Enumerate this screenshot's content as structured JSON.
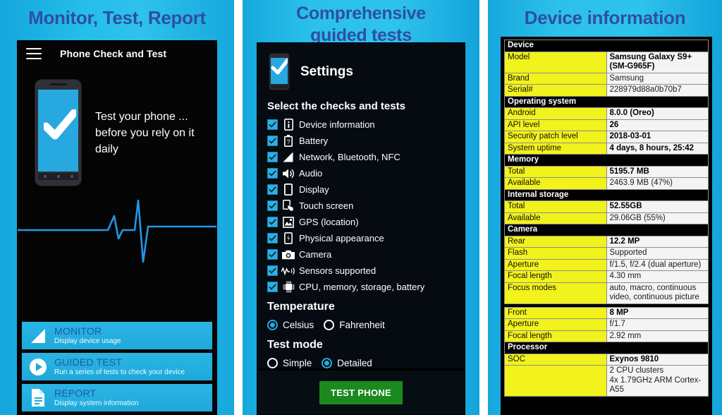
{
  "panels": {
    "left": {
      "headline": "Monitor, Test, Report",
      "app_title": "Phone Check and Test",
      "menu_icon": "hamburger-menu-icon",
      "hero_line1": "Test your phone ...",
      "hero_line2": "before you rely on it daily",
      "menu": [
        {
          "icon": "signal-bars-icon",
          "title": "MONITOR",
          "subtitle": "Display device usage"
        },
        {
          "icon": "play-circle-icon",
          "title": "GUIDED TEST",
          "subtitle": "Run a series of tests to check your device"
        },
        {
          "icon": "document-icon",
          "title": "REPORT",
          "subtitle": "Display system information"
        }
      ]
    },
    "middle": {
      "headline_line1": "Comprehensive",
      "headline_line2": "guided tests",
      "settings_title": "Settings",
      "select_title": "Select the checks and tests",
      "checks": [
        {
          "label": "Device information",
          "icon": "info-phone-icon",
          "checked": true
        },
        {
          "label": "Battery",
          "icon": "battery-question-icon",
          "checked": true
        },
        {
          "label": "Network, Bluetooth, NFC",
          "icon": "signal-bars-icon",
          "checked": true
        },
        {
          "label": "Audio",
          "icon": "speaker-icon",
          "checked": true
        },
        {
          "label": "Display",
          "icon": "phone-outline-icon",
          "checked": true
        },
        {
          "label": "Touch screen",
          "icon": "touch-hand-icon",
          "checked": true
        },
        {
          "label": "GPS (location)",
          "icon": "map-pin-icon",
          "checked": true
        },
        {
          "label": "Physical appearance",
          "icon": "phone-body-icon",
          "checked": true
        },
        {
          "label": "Camera",
          "icon": "camera-icon",
          "checked": true
        },
        {
          "label": "Sensors supported",
          "icon": "sensor-wave-icon",
          "checked": true
        },
        {
          "label": "CPU, memory, storage, battery",
          "icon": "cpu-chip-icon",
          "checked": true
        }
      ],
      "temperature": {
        "heading": "Temperature",
        "options": [
          {
            "label": "Celsius",
            "selected": true
          },
          {
            "label": "Fahrenheit",
            "selected": false
          }
        ]
      },
      "test_mode": {
        "heading": "Test mode",
        "options": [
          {
            "label": "Simple",
            "selected": false
          },
          {
            "label": "Detailed",
            "selected": true
          }
        ]
      },
      "test_button": "TEST PHONE"
    },
    "right": {
      "headline": "Device information",
      "sections": [
        {
          "title": "Device",
          "rows": [
            {
              "key": "Model",
              "value": "Samsung Galaxy S9+ (SM-G965F)",
              "bold": true
            },
            {
              "key": "Brand",
              "value": "Samsung",
              "bold": false
            },
            {
              "key": "Serial#",
              "value": "228979d88a0b70b7",
              "bold": false
            }
          ]
        },
        {
          "title": "Operating system",
          "rows": [
            {
              "key": "Android",
              "value": "8.0.0 (Oreo)",
              "bold": true
            },
            {
              "key": "API level",
              "value": "26",
              "bold": true
            },
            {
              "key": "Security patch level",
              "value": "2018-03-01",
              "bold": true
            },
            {
              "key": "System uptime",
              "value": "4 days, 8 hours, 25:42",
              "bold": true
            }
          ]
        },
        {
          "title": "Memory",
          "rows": [
            {
              "key": "Total",
              "value": "5195.7 MB",
              "bold": true
            },
            {
              "key": "Available",
              "value": "2463.9 MB (47%)",
              "bold": false
            }
          ]
        },
        {
          "title": "Internal storage",
          "rows": [
            {
              "key": "Total",
              "value": "52.55GB",
              "bold": true
            },
            {
              "key": "Available",
              "value": "29.06GB (55%)",
              "bold": false
            }
          ]
        },
        {
          "title": "Camera",
          "rows": [
            {
              "key": "Rear",
              "value": "12.2 MP",
              "bold": true
            },
            {
              "key": "Flash",
              "value": "Supported",
              "bold": false
            },
            {
              "key": "Aperture",
              "value": "f/1.5, f/2.4 (dual aperture)",
              "bold": false
            },
            {
              "key": "Focal length",
              "value": "4.30 mm",
              "bold": false
            },
            {
              "key": "Focus modes",
              "value": "auto, macro, continuous video, continuous picture",
              "bold": false
            },
            {
              "key": "Front",
              "value": "8 MP",
              "bold": true,
              "spacer_before": true
            },
            {
              "key": "Aperture",
              "value": "f/1.7",
              "bold": false
            },
            {
              "key": "Focal length",
              "value": "2.92 mm",
              "bold": false
            }
          ]
        },
        {
          "title": "Processor",
          "rows": [
            {
              "key": "SOC",
              "value": "Exynos 9810",
              "bold": true
            },
            {
              "key": "",
              "value": "2 CPU clusters\n4x 1.79GHz ARM Cortex-A55",
              "bold": false
            }
          ]
        }
      ]
    }
  },
  "colors": {
    "panel_cyan": "#2cc1eb",
    "headline_blue": "#2d4fa2",
    "accent_blue": "#27a9e0",
    "key_yellow": "#f2f21c",
    "button_green": "#1a8a1e"
  }
}
